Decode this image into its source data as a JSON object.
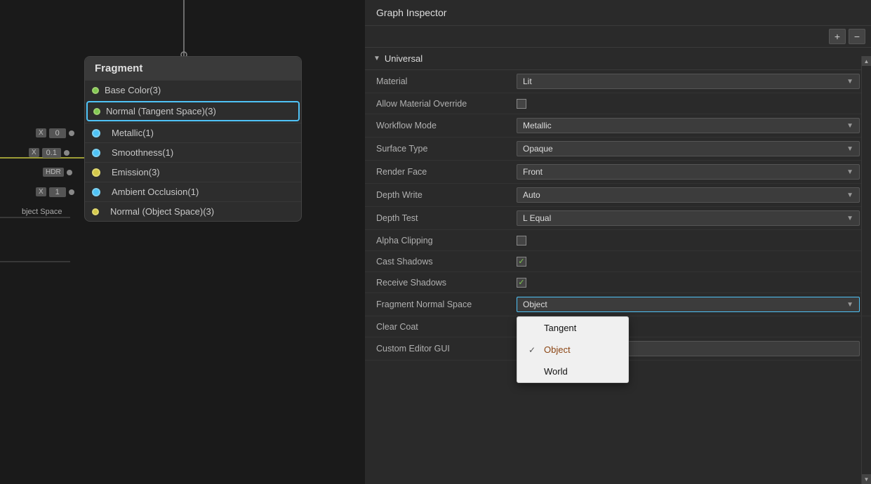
{
  "left": {
    "fragment_title": "Fragment",
    "rows": [
      {
        "id": "base-color",
        "label": "Base Color(3)",
        "dot": "green",
        "selected": false,
        "has_left": false
      },
      {
        "id": "normal-tangent",
        "label": "Normal (Tangent Space)(3)",
        "dot": "green",
        "selected": true,
        "has_left": false
      },
      {
        "id": "metallic",
        "label": "Metallic(1)",
        "dot": "blue",
        "selected": false,
        "has_left": true,
        "left_x": "X",
        "left_val": "0"
      },
      {
        "id": "smoothness",
        "label": "Smoothness(1)",
        "dot": "blue",
        "selected": false,
        "has_left": true,
        "left_x": "X",
        "left_val": "0.1"
      },
      {
        "id": "emission",
        "label": "Emission(3)",
        "dot": "yellow",
        "selected": false,
        "has_left": true,
        "left_x": "HDR",
        "left_val": ""
      },
      {
        "id": "ambient-occlusion",
        "label": "Ambient Occlusion(1)",
        "dot": "blue",
        "selected": false,
        "has_left": true,
        "left_x": "X",
        "left_val": "1"
      },
      {
        "id": "normal-object",
        "label": "Normal (Object Space)(3)",
        "dot": "yellow",
        "selected": false,
        "has_left": false,
        "object_space_label": "bject Space"
      }
    ]
  },
  "right": {
    "title": "Graph Inspector",
    "toolbar": {
      "plus_label": "+",
      "minus_label": "−"
    },
    "section": {
      "title": "Universal",
      "properties": [
        {
          "id": "material",
          "label": "Material",
          "type": "dropdown",
          "value": "Lit"
        },
        {
          "id": "allow-material-override",
          "label": "Allow Material Override",
          "type": "checkbox",
          "checked": false
        },
        {
          "id": "workflow-mode",
          "label": "Workflow Mode",
          "type": "dropdown",
          "value": "Metallic"
        },
        {
          "id": "surface-type",
          "label": "Surface Type",
          "type": "dropdown",
          "value": "Opaque"
        },
        {
          "id": "render-face",
          "label": "Render Face",
          "type": "dropdown",
          "value": "Front"
        },
        {
          "id": "depth-write",
          "label": "Depth Write",
          "type": "dropdown",
          "value": "Auto"
        },
        {
          "id": "depth-test",
          "label": "Depth Test",
          "type": "dropdown",
          "value": "L Equal"
        },
        {
          "id": "alpha-clipping",
          "label": "Alpha Clipping",
          "type": "checkbox",
          "checked": false
        },
        {
          "id": "cast-shadows",
          "label": "Cast Shadows",
          "type": "checkbox",
          "checked": true
        },
        {
          "id": "receive-shadows",
          "label": "Receive Shadows",
          "type": "checkbox",
          "checked": true
        },
        {
          "id": "fragment-normal-space",
          "label": "Fragment Normal Space",
          "type": "dropdown",
          "value": "Object",
          "highlighted": true
        },
        {
          "id": "clear-coat",
          "label": "Clear Coat",
          "type": "checkbox",
          "checked": false
        },
        {
          "id": "custom-editor-gui",
          "label": "Custom Editor GUI",
          "type": "text",
          "value": ""
        }
      ]
    },
    "popup": {
      "options": [
        {
          "label": "Tangent",
          "selected": false
        },
        {
          "label": "Object",
          "selected": true
        },
        {
          "label": "World",
          "selected": false
        }
      ]
    }
  }
}
